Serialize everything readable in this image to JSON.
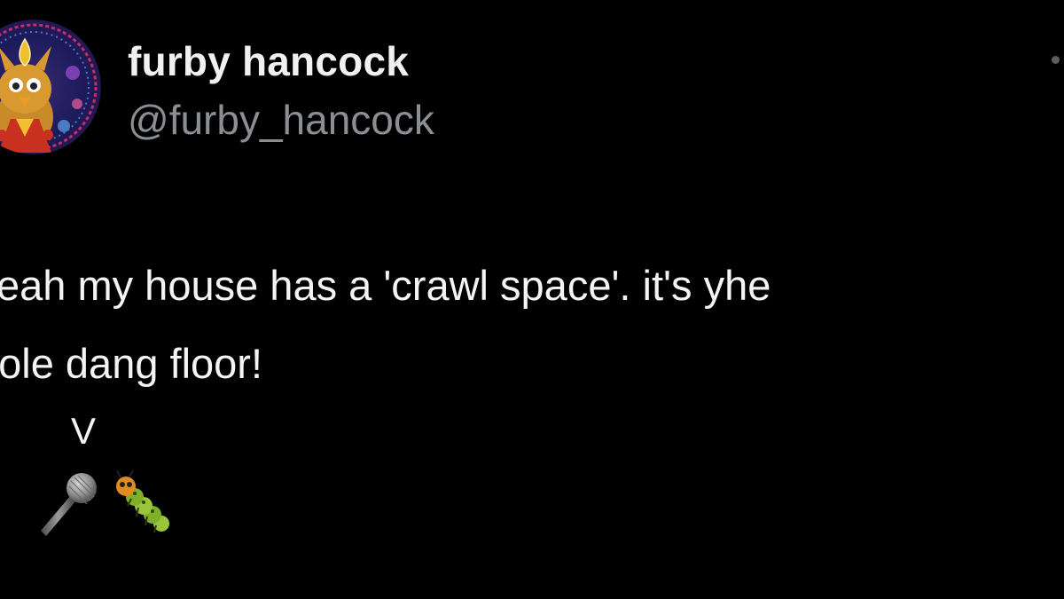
{
  "author": {
    "display_name": "furby hancock",
    "handle": "@furby_hancock"
  },
  "tweet": {
    "line_1": "eah my house has a 'crawl space'. it's yhe",
    "line_2": "hole dang floor!",
    "pointer": "V"
  },
  "icons": {
    "avatar": "furby-avatar",
    "more": "more-options-icon",
    "emoji_1": "microphone-icon",
    "emoji_2": "caterpillar-icon"
  },
  "colors": {
    "background": "#000000",
    "text": "#f4f4f4",
    "handle": "#8b8f94"
  }
}
